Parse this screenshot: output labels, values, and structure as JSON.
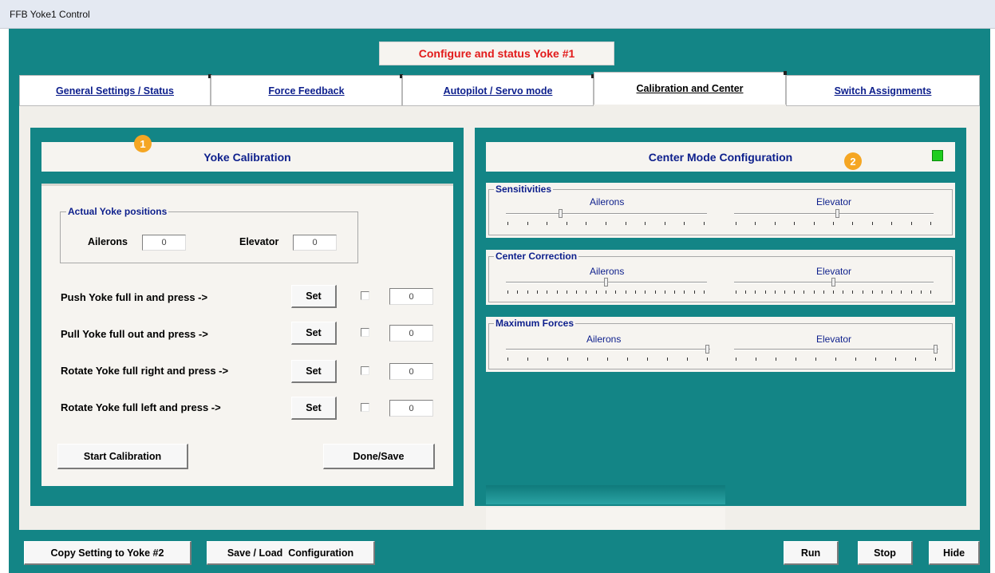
{
  "window": {
    "title": "FFB Yoke1 Control"
  },
  "header": {
    "title": "Configure and status Yoke #1"
  },
  "tabs": [
    {
      "label": "General Settings / Status",
      "active": false
    },
    {
      "label": "Force Feedback",
      "active": false
    },
    {
      "label": "Autopilot / Servo mode",
      "active": false
    },
    {
      "label": "Calibration and Center",
      "active": true
    },
    {
      "label": "Switch Assignments",
      "active": false
    }
  ],
  "calibration": {
    "badge": "1",
    "title": "Yoke Calibration",
    "positions_group": "Actual Yoke positions",
    "ailerons_label": "Ailerons",
    "ailerons_value": "0",
    "elevator_label": "Elevator",
    "elevator_value": "0",
    "steps": [
      {
        "label": "Push Yoke full in and press ->",
        "button": "Set",
        "value": "0"
      },
      {
        "label": "Pull Yoke full out and press ->",
        "button": "Set",
        "value": "0"
      },
      {
        "label": "Rotate Yoke full right and press ->",
        "button": "Set",
        "value": "0"
      },
      {
        "label": "Rotate Yoke full left and press ->",
        "button": "Set",
        "value": "0"
      }
    ],
    "start_button": "Start Calibration",
    "done_button": "Done/Save"
  },
  "center": {
    "badge": "2",
    "title": "Center Mode Configuration",
    "status_color": "#1fcd1f",
    "groups": [
      {
        "label": "Sensitivities",
        "ailerons_label": "Ailerons",
        "elevator_label": "Elevator",
        "ailerons_level": 0.27,
        "elevator_level": 0.52,
        "tick_count": 11
      },
      {
        "label": "Center Correction",
        "ailerons_label": "Ailerons",
        "elevator_label": "Elevator",
        "ailerons_level": 0.5,
        "elevator_level": 0.5,
        "tick_count": 21
      },
      {
        "label": "Maximum Forces",
        "ailerons_label": "Ailerons",
        "elevator_label": "Elevator",
        "ailerons_level": 1.0,
        "elevator_level": 1.0,
        "tick_count": 11
      }
    ]
  },
  "footer": {
    "copy_button": "Copy Setting to Yoke #2",
    "save_load_button": "Save / Load  Configuration",
    "run_button": "Run",
    "stop_button": "Stop",
    "hide_button": "Hide"
  },
  "colors": {
    "background": "#138586",
    "panel": "#f6f4f0",
    "header_text": "#e21a1a",
    "label_text": "#0d1f8c"
  }
}
